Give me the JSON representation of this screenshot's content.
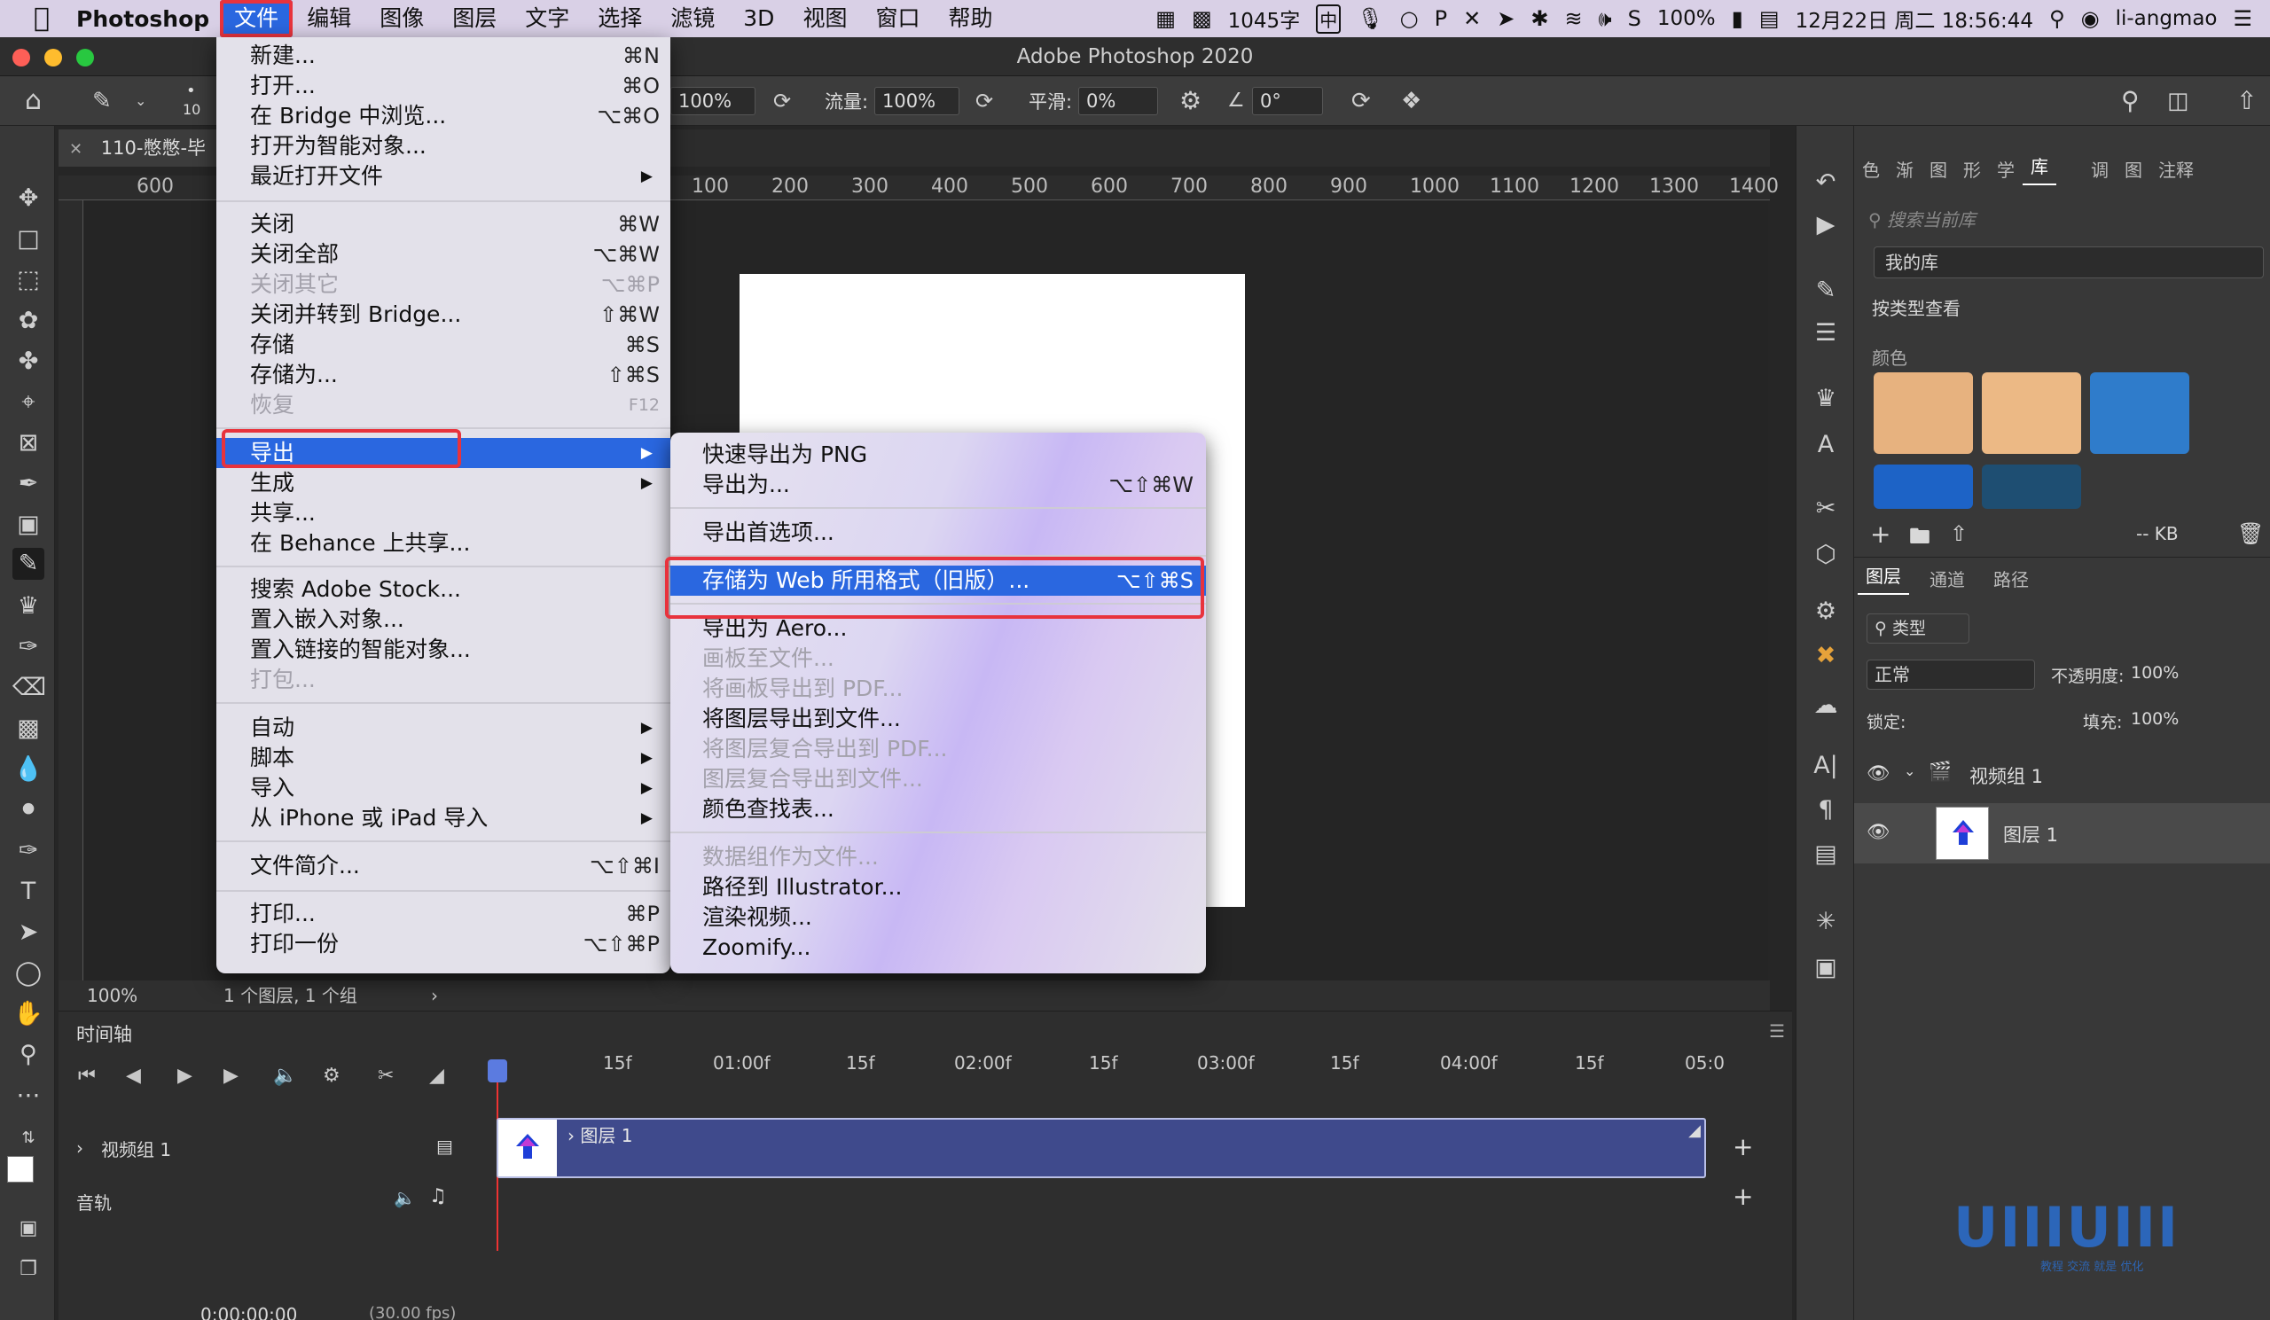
{
  "menubar": {
    "app_name": "Photoshop",
    "items": [
      "文件",
      "编辑",
      "图像",
      "图层",
      "文字",
      "选择",
      "滤镜",
      "3D",
      "视图",
      "窗口",
      "帮助"
    ],
    "word_count": "1045字",
    "ime": "中",
    "battery": "100%",
    "datetime": "12月22日 周二 18:56:44",
    "user": "li-angmao"
  },
  "window": {
    "title": "Adobe Photoshop 2020"
  },
  "options_bar": {
    "brush_size": "10",
    "opacity": "100%",
    "flow_label": "流量:",
    "flow": "100%",
    "smoothing_label": "平滑:",
    "smoothing": "0%",
    "angle": "0°"
  },
  "document": {
    "tab_title": "110-憋憋-毕",
    "ruler_ticks": [
      "600",
      "100",
      "200",
      "300",
      "400",
      "500",
      "600",
      "700",
      "800",
      "900",
      "1000",
      "1100",
      "1200",
      "1300",
      "1400"
    ],
    "zoom": "100%",
    "status": "1 个图层, 1 个组"
  },
  "file_menu": {
    "items": [
      {
        "label": "新建...",
        "shortcut": "⌘N"
      },
      {
        "label": "打开...",
        "shortcut": "⌘O"
      },
      {
        "label": "在 Bridge 中浏览...",
        "shortcut": "⌥⌘O"
      },
      {
        "label": "打开为智能对象...",
        "shortcut": ""
      },
      {
        "label": "最近打开文件",
        "shortcut": ""
      },
      {
        "label": "关闭",
        "shortcut": "⌘W"
      },
      {
        "label": "关闭全部",
        "shortcut": "⌥⌘W"
      },
      {
        "label": "关闭其它",
        "shortcut": "⌥⌘P"
      },
      {
        "label": "关闭并转到 Bridge...",
        "shortcut": "⇧⌘W"
      },
      {
        "label": "存储",
        "shortcut": "⌘S"
      },
      {
        "label": "存储为...",
        "shortcut": "⇧⌘S"
      },
      {
        "label": "恢复",
        "shortcut": "F12"
      },
      {
        "label": "导出",
        "shortcut": ""
      },
      {
        "label": "生成",
        "shortcut": ""
      },
      {
        "label": "共享...",
        "shortcut": ""
      },
      {
        "label": "在 Behance 上共享...",
        "shortcut": ""
      },
      {
        "label": "搜索 Adobe Stock...",
        "shortcut": ""
      },
      {
        "label": "置入嵌入对象...",
        "shortcut": ""
      },
      {
        "label": "置入链接的智能对象...",
        "shortcut": ""
      },
      {
        "label": "打包...",
        "shortcut": ""
      },
      {
        "label": "自动",
        "shortcut": ""
      },
      {
        "label": "脚本",
        "shortcut": ""
      },
      {
        "label": "导入",
        "shortcut": ""
      },
      {
        "label": "从 iPhone 或 iPad 导入",
        "shortcut": ""
      },
      {
        "label": "文件简介...",
        "shortcut": "⌥⇧⌘I"
      },
      {
        "label": "打印...",
        "shortcut": "⌘P"
      },
      {
        "label": "打印一份",
        "shortcut": "⌥⇧⌘P"
      }
    ]
  },
  "export_submenu": {
    "items": [
      {
        "label": "快速导出为 PNG",
        "shortcut": ""
      },
      {
        "label": "导出为...",
        "shortcut": "⌥⇧⌘W"
      },
      {
        "label": "导出首选项...",
        "shortcut": ""
      },
      {
        "label": "存储为 Web 所用格式（旧版）...",
        "shortcut": "⌥⇧⌘S"
      },
      {
        "label": "导出为 Aero...",
        "shortcut": ""
      },
      {
        "label": "画板至文件...",
        "shortcut": ""
      },
      {
        "label": "将画板导出到 PDF...",
        "shortcut": ""
      },
      {
        "label": "将图层导出到文件...",
        "shortcut": ""
      },
      {
        "label": "将图层复合导出到 PDF...",
        "shortcut": ""
      },
      {
        "label": "图层复合导出到文件...",
        "shortcut": ""
      },
      {
        "label": "颜色查找表...",
        "shortcut": ""
      },
      {
        "label": "数据组作为文件...",
        "shortcut": ""
      },
      {
        "label": "路径到 Illustrator...",
        "shortcut": ""
      },
      {
        "label": "渲染视频...",
        "shortcut": ""
      },
      {
        "label": "Zoomify...",
        "shortcut": ""
      }
    ]
  },
  "timeline": {
    "title": "时间轴",
    "ticks": [
      "15f",
      "01:00f",
      "15f",
      "02:00f",
      "15f",
      "03:00f",
      "15f",
      "04:00f",
      "15f",
      "05:0"
    ],
    "video_group": "视频组 1",
    "clip_label": "图层 1",
    "audio_track": "音轨",
    "timecode": "0:00:00:00",
    "fps": "(30.00 fps)"
  },
  "library_panel": {
    "tabs": [
      "色",
      "渐",
      "图",
      "形",
      "学",
      "库",
      "调",
      "图",
      "注释"
    ],
    "search_placeholder": "搜索当前库",
    "library_name": "我的库",
    "view_by": "按类型查看",
    "section": "颜色",
    "swatches": [
      "#e7b27f",
      "#ecb985",
      "#2f7ccb",
      "#1d63c6",
      "#1e4e72"
    ],
    "size": "-- KB"
  },
  "layers_panel": {
    "tabs": [
      "图层",
      "通道",
      "路径"
    ],
    "filter": "类型",
    "blend_mode": "正常",
    "opacity_label": "不透明度:",
    "opacity": "100%",
    "lock_label": "锁定:",
    "fill_label": "填充:",
    "fill": "100%",
    "layers": [
      "视频组 1",
      "图层 1"
    ]
  },
  "watermark": {
    "text": "UIIIUIII",
    "sub": "教程 交流 就是 优化"
  }
}
